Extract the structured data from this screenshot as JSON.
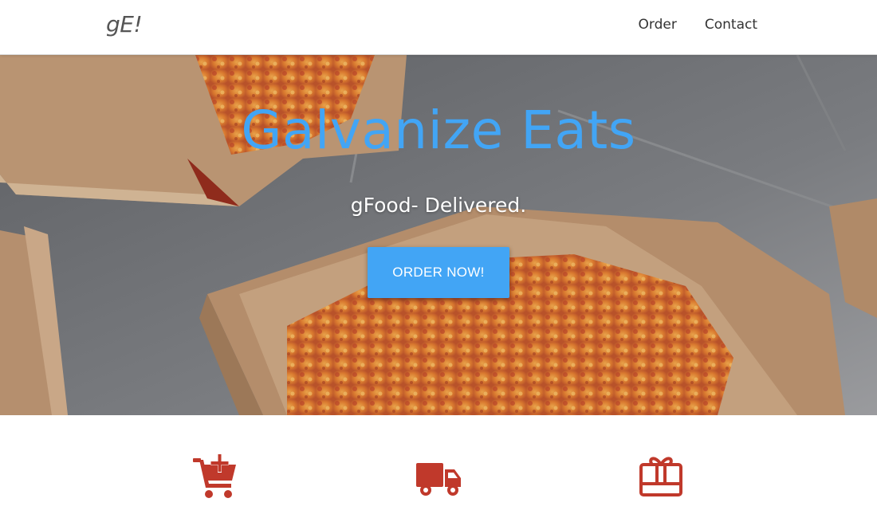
{
  "colors": {
    "brand_blue": "#42a5f5",
    "icon_red": "#c0392b",
    "navbar_bg": "#ffffff"
  },
  "navbar": {
    "brand": "gE!",
    "links": [
      {
        "label": "Order"
      },
      {
        "label": "Contact"
      }
    ]
  },
  "hero": {
    "title": "Galvanize Eats",
    "subtitle": "gFood- Delivered.",
    "cta_label": "ORDER NOW!"
  },
  "features": {
    "icons": [
      "cart-plus-icon",
      "truck-icon",
      "gift-card-icon"
    ]
  }
}
